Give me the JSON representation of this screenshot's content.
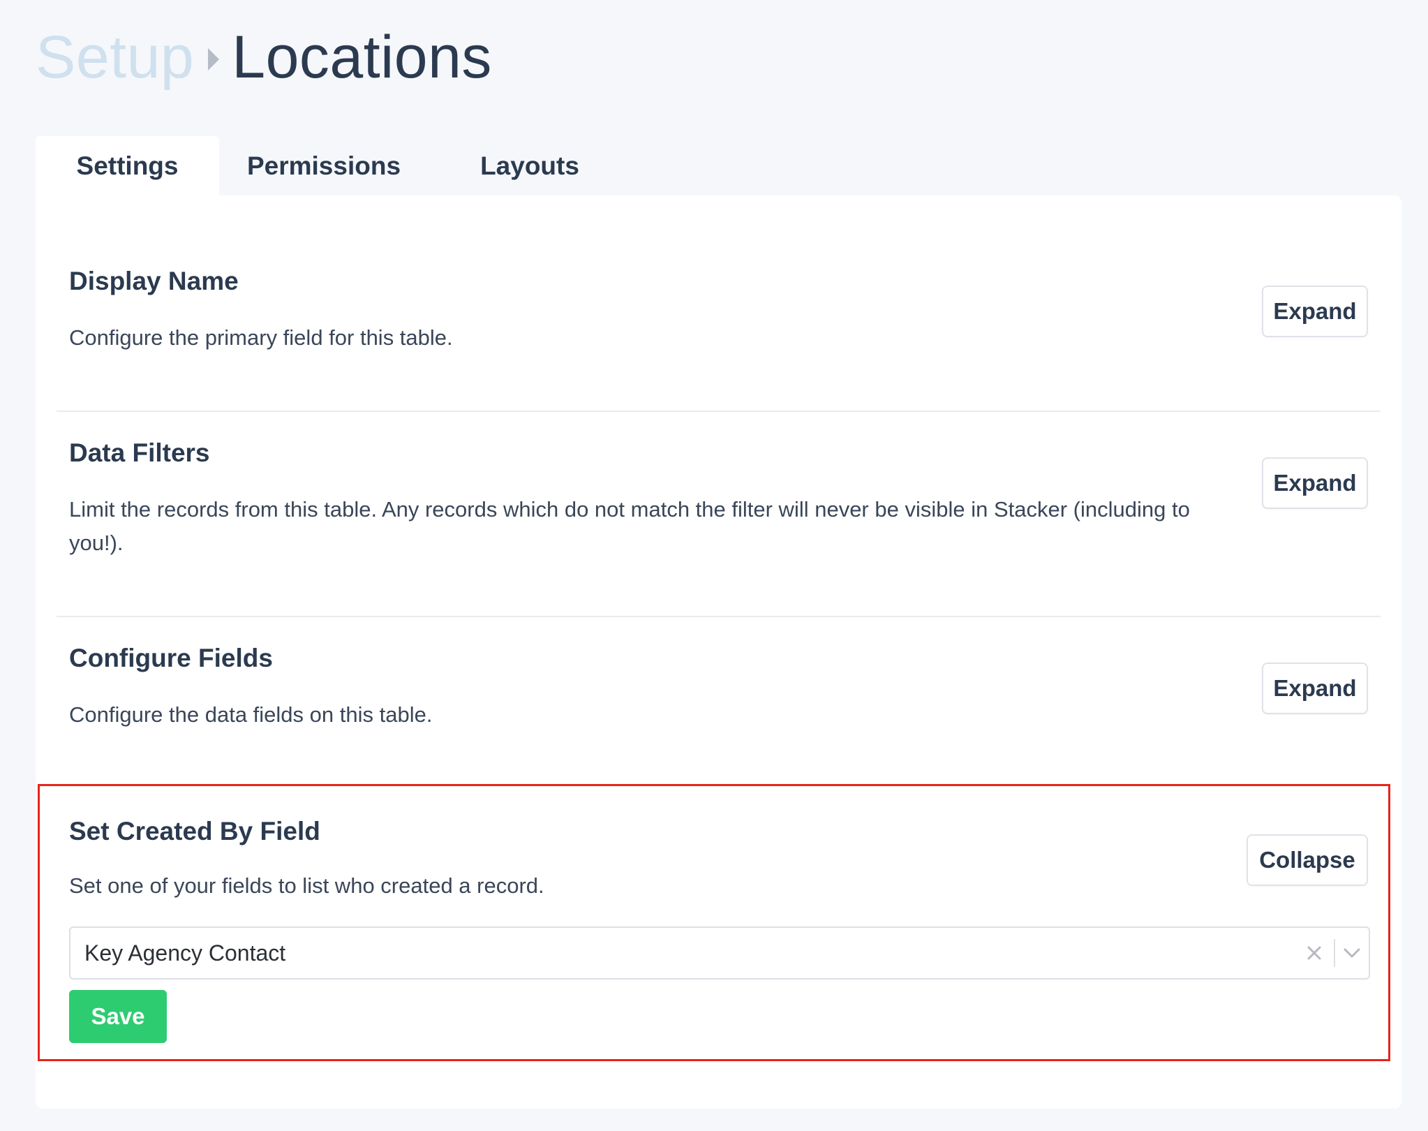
{
  "breadcrumb": {
    "root": "Setup",
    "current": "Locations"
  },
  "tabs": [
    {
      "label": "Settings",
      "active": true
    },
    {
      "label": "Permissions",
      "active": false
    },
    {
      "label": "Layouts",
      "active": false
    }
  ],
  "sections": [
    {
      "title": "Display Name",
      "description": "Configure the primary field for this table.",
      "button": "Expand"
    },
    {
      "title": "Data Filters",
      "description": "Limit the records from this table. Any records which do not match the filter will never be visible in Stacker (including to you!).",
      "button": "Expand"
    },
    {
      "title": "Configure Fields",
      "description": "Configure the data fields on this table.",
      "button": "Expand"
    },
    {
      "title": "Set Created By Field",
      "description": "Set one of your fields to list who created a record.",
      "button": "Collapse",
      "select_value": "Key Agency Contact",
      "save_label": "Save"
    }
  ],
  "colors": {
    "accent_green": "#2ecc71",
    "highlight_red": "#e8241b",
    "text_dark": "#2b3a4f",
    "breadcrumb_light": "#cfe0ee"
  },
  "icons": [
    "chevron-right-icon",
    "clear-x-icon",
    "chevron-down-icon"
  ]
}
